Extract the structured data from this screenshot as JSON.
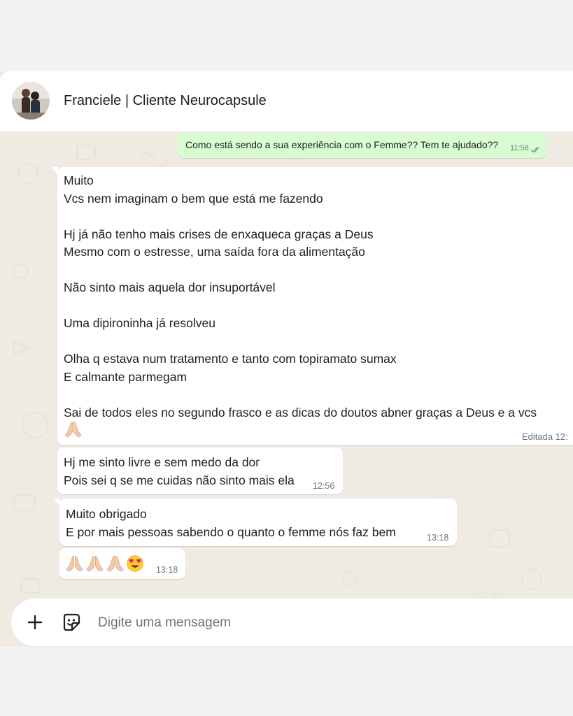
{
  "header": {
    "contact_name": "Franciele | Cliente Neurocapsule"
  },
  "messages": [
    {
      "direction": "out",
      "text": "Como está sendo a sua experiência com o Femme?? Tem te ajudado??",
      "time": "11:58",
      "status": "double-check-read-icon"
    },
    {
      "direction": "in",
      "text": "Muito\nVcs nem imaginam o bem que está me fazendo\n\nHj já não tenho mais crises de enxaqueca graças a Deus\nMesmo com o estresse, uma saída fora da alimentação\n\nNão sinto mais aquela dor insuportável\n\nUma dipironinha já resolveu\n\nOlha q estava num tratamento e tanto com topiramato sumax\nE calmante parmegam\n\nSai de todos eles no segundo frasco e as dicas do doutos abner graças a Deus e a vcs",
      "emoji": "praying-hands",
      "time": "Editada 12:"
    },
    {
      "direction": "in",
      "text": "Hj me sinto livre e sem medo da dor\nPois sei q se me cuidas não sinto mais ela",
      "time": "12:56"
    },
    {
      "direction": "in",
      "text": "Muito obrigado\nE por mais pessoas sabendo o quanto o femme nós faz bem",
      "time": "13:18"
    },
    {
      "direction": "in",
      "emojis": [
        "praying-hands",
        "praying-hands",
        "praying-hands",
        "heart-eyes-face"
      ],
      "time": "13:18"
    }
  ],
  "composer": {
    "placeholder": "Digite uma mensagem",
    "add_icon": "plus-icon",
    "sticker_icon": "sticker-icon"
  },
  "colors": {
    "outgoing_bubble": "#d9fdd3",
    "incoming_bubble": "#ffffff",
    "chat_background": "#efeae2",
    "timestamp": "#667781",
    "read_check": "#53bdeb"
  }
}
